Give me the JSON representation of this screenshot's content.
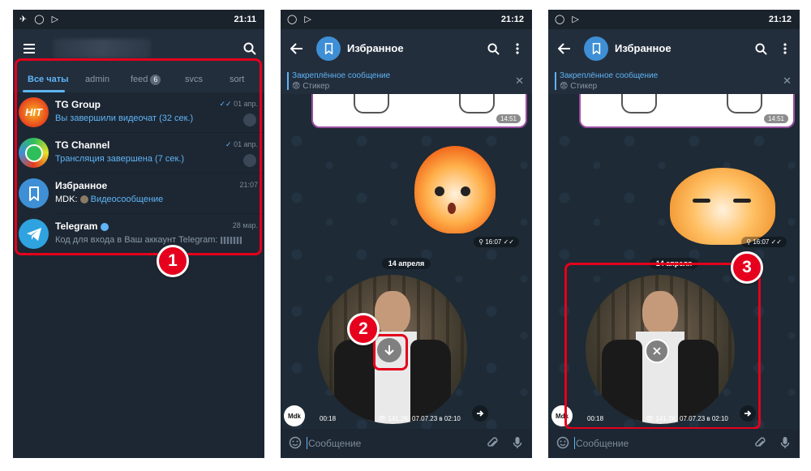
{
  "status_bar": {
    "time_left": "21:11",
    "time_right": "21:12"
  },
  "chat_list": {
    "tabs": [
      {
        "label": "Все чаты"
      },
      {
        "label": "admin"
      },
      {
        "label": "feed",
        "badge": "6"
      },
      {
        "label": "svcs"
      },
      {
        "label": "sort"
      }
    ],
    "chats": [
      {
        "title": "TG Group",
        "avatar_text": "HIT",
        "subtitle": "Вы завершили видеочат (32 сек.)",
        "time": "01 апр.",
        "avatar_color": "#e83a1f"
      },
      {
        "title": "TG Channel",
        "subtitle": "Трансляция завершена (7 сек.)",
        "time": "01 апр.",
        "avatar_color": "#2fbf5a"
      },
      {
        "title": "Избранное",
        "subtitle_prefix": "MDK:",
        "subtitle": "Видеосообщение",
        "time": "21:07",
        "avatar_color": "#3e8fd6"
      },
      {
        "title": "Telegram",
        "subtitle": "Код для входа в Ваш аккаунт Telegram:",
        "time": "28 мар.",
        "avatar_color": "#2fa3e0"
      }
    ]
  },
  "chat_view": {
    "title": "Избранное",
    "pinned_title": "Закреплённое сообщение",
    "pinned_sub": "😨 Стикер",
    "sticker_time_top": "14:51",
    "sticker_time": "16:07",
    "date_label": "14 апреля",
    "video_duration": "00:18",
    "video_views": "141.2K",
    "video_date": "07.07.23 в 02:10",
    "avatar_label": "Mdk",
    "input_placeholder": "Сообщение"
  },
  "steps": [
    "1",
    "2",
    "3"
  ],
  "colors": {
    "accent": "#5eb5f7",
    "highlight_red": "#e5001b",
    "background": "#1d2733"
  }
}
